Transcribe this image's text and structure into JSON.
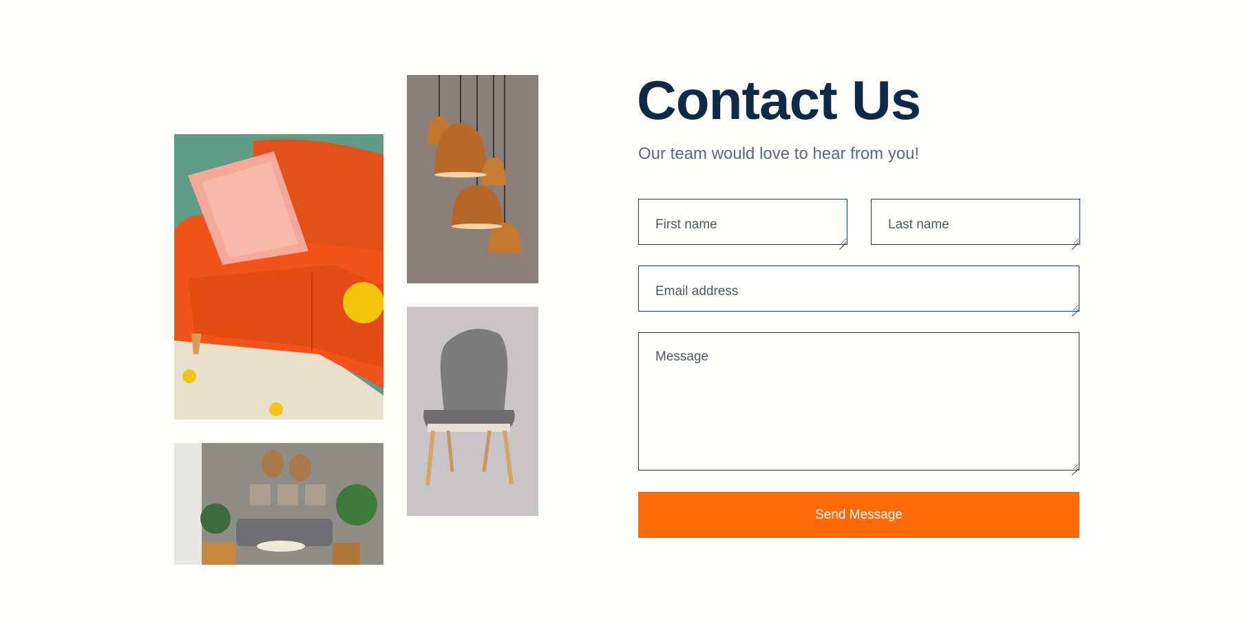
{
  "contact": {
    "title": "Contact Us",
    "subtitle": "Our team would love to hear from you!",
    "form": {
      "first_name_placeholder": "First name",
      "last_name_placeholder": "Last name",
      "email_placeholder": "Email address",
      "message_placeholder": "Message",
      "submit_label": "Send Message"
    }
  },
  "colors": {
    "background": "#fdfdfa",
    "heading": "#0e2a47",
    "field_border": "#163a66",
    "accent_button": "#ff6a08"
  },
  "images": [
    {
      "name": "orange-sofa-photo"
    },
    {
      "name": "pendant-lamps-photo"
    },
    {
      "name": "grey-chair-photo"
    },
    {
      "name": "living-room-photo"
    }
  ]
}
